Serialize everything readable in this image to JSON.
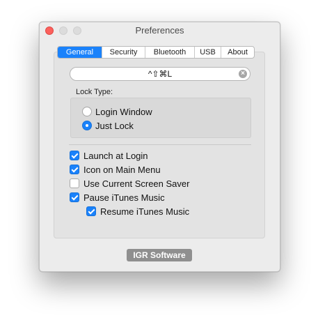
{
  "window": {
    "title": "Preferences"
  },
  "tabs": [
    {
      "label": "General",
      "active": true
    },
    {
      "label": "Security",
      "active": false
    },
    {
      "label": "Bluetooth",
      "active": false
    },
    {
      "label": "USB",
      "active": false
    },
    {
      "label": "About",
      "active": false
    }
  ],
  "shortcut": {
    "value": "^⇧⌘L",
    "clear_icon": "clear-circle-icon"
  },
  "lock_type": {
    "label": "Lock Type:",
    "options": [
      {
        "label": "Login Window",
        "selected": false
      },
      {
        "label": "Just Lock",
        "selected": true
      }
    ]
  },
  "options": [
    {
      "label": "Launch at Login",
      "checked": true
    },
    {
      "label": "Icon on Main Menu",
      "checked": true
    },
    {
      "label": "Use Current Screen Saver",
      "checked": false
    },
    {
      "label": "Pause iTunes Music",
      "checked": true
    },
    {
      "label": "Resume iTunes Music",
      "checked": true
    }
  ],
  "footer": {
    "brand": "IGR Software"
  },
  "colors": {
    "accent": "#1a82fb",
    "close": "#fc605c"
  }
}
